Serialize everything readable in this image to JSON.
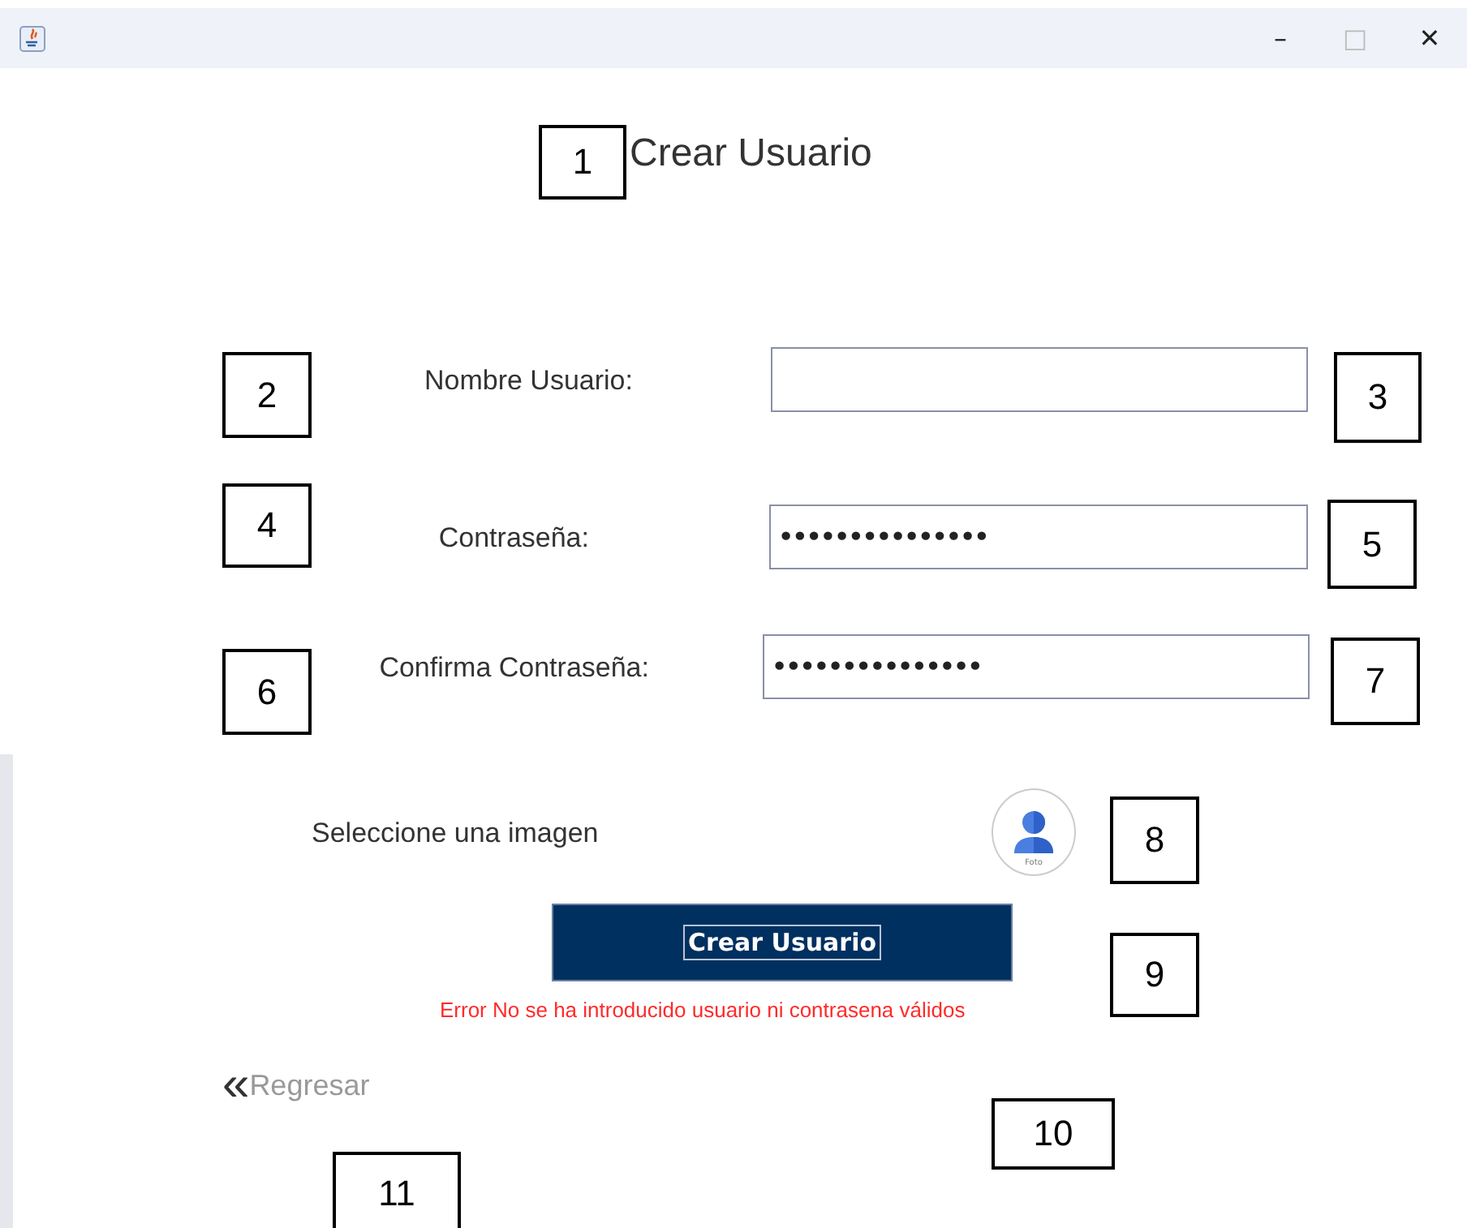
{
  "window": {
    "controls": [
      "–",
      "□",
      "✕"
    ]
  },
  "title": "Crear Usuario",
  "fields": [
    {
      "label": "Nombre Usuario:",
      "kind": "text"
    },
    {
      "label": "Contraseña:",
      "kind": "password",
      "value": "•••••••••••••••"
    },
    {
      "label": "Confirma Contraseña:",
      "kind": "password",
      "value": "•••••••••••••••"
    }
  ],
  "image_picker": {
    "label": "Seleccione una imagen",
    "caption": "Foto"
  },
  "submit_button": "Crear Usuario",
  "error": "Error No se ha introducido usuario ni contrasena válidos",
  "back_link": {
    "icon": "«",
    "label": "Regresar"
  },
  "annotations": [
    "1",
    "2",
    "3",
    "4",
    "5",
    "6",
    "7",
    "8",
    "9",
    "10",
    "11"
  ]
}
